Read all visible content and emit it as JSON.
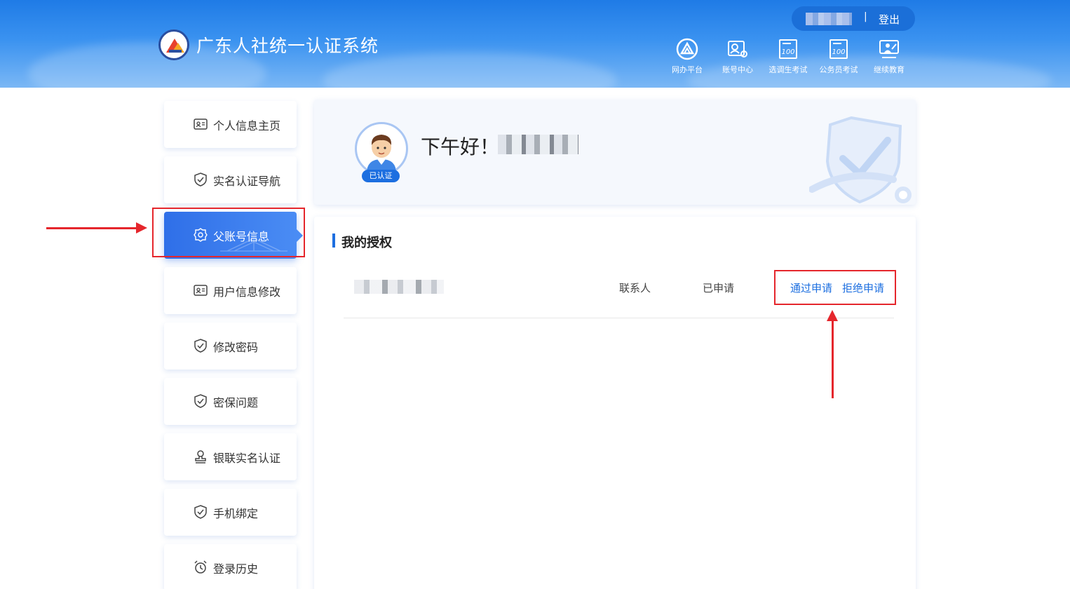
{
  "header": {
    "system_title": "广东人社统一认证系统",
    "separator": "|",
    "logout_label": "登出",
    "nav": [
      {
        "label": "网办平台",
        "icon": "service-platform-icon"
      },
      {
        "label": "账号中心",
        "icon": "account-center-icon"
      },
      {
        "label": "选调生考试",
        "icon": "exam-100-icon"
      },
      {
        "label": "公务员考试",
        "icon": "exam-100-icon"
      },
      {
        "label": "继续教育",
        "icon": "education-icon"
      }
    ]
  },
  "sidebar": {
    "items": [
      {
        "label": "个人信息主页",
        "icon": "id-card-icon"
      },
      {
        "label": "实名认证导航",
        "icon": "shield-check-icon"
      },
      {
        "label": "父账号信息",
        "icon": "badge-icon",
        "active": true
      },
      {
        "label": "用户信息修改",
        "icon": "id-card-icon"
      },
      {
        "label": "修改密码",
        "icon": "shield-check-icon"
      },
      {
        "label": "密保问题",
        "icon": "shield-check-icon"
      },
      {
        "label": "银联实名认证",
        "icon": "stamp-icon"
      },
      {
        "label": "手机绑定",
        "icon": "shield-check-icon"
      },
      {
        "label": "登录历史",
        "icon": "alarm-clock-icon"
      }
    ]
  },
  "welcome": {
    "greeting": "下午好！",
    "verified_badge": "已认证"
  },
  "authorization": {
    "title": "我的授权",
    "rows": [
      {
        "role": "联系人",
        "status": "已申请",
        "approve_label": "通过申请",
        "reject_label": "拒绝申请"
      }
    ]
  },
  "colors": {
    "accent": "#1d6fe0",
    "annotation": "#e5262c"
  }
}
